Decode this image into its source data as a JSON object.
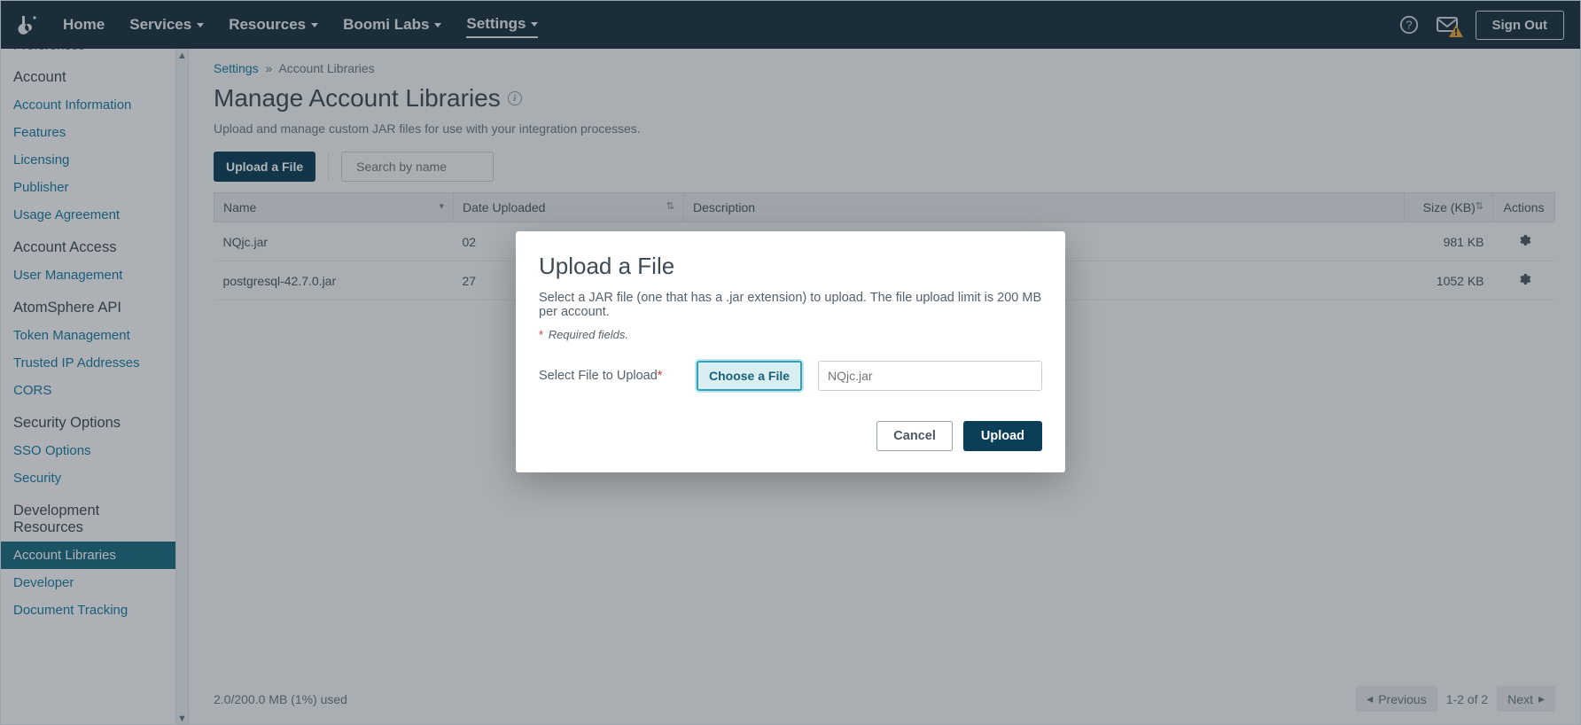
{
  "nav": {
    "home": "Home",
    "services": "Services",
    "resources": "Resources",
    "boomi_labs": "Boomi Labs",
    "settings": "Settings",
    "sign_out": "Sign Out"
  },
  "sidebar": {
    "cutoff_top": "Preferences",
    "groups": [
      {
        "title": "Account",
        "items": [
          "Account Information",
          "Features",
          "Licensing",
          "Publisher",
          "Usage Agreement"
        ]
      },
      {
        "title": "Account Access",
        "items": [
          "User Management"
        ]
      },
      {
        "title": "AtomSphere API",
        "items": [
          "Token Management",
          "Trusted IP Addresses",
          "CORS"
        ]
      },
      {
        "title": "Security Options",
        "items": [
          "SSO Options",
          "Security"
        ]
      },
      {
        "title": "Development Resources",
        "items": [
          "Account Libraries",
          "Developer",
          "Document Tracking"
        ],
        "active_index": 0
      }
    ]
  },
  "breadcrumb": {
    "root": "Settings",
    "sep": "»",
    "leaf": "Account Libraries"
  },
  "page": {
    "title": "Manage Account Libraries",
    "subtitle": "Upload and manage custom JAR files for use with your integration processes.",
    "upload_btn": "Upload a File",
    "search_placeholder": "Search by name"
  },
  "table": {
    "headers": {
      "name": "Name",
      "date": "Date Uploaded",
      "desc": "Description",
      "size": "Size (KB)",
      "actions": "Actions"
    },
    "rows": [
      {
        "name": "NQjc.jar",
        "date": "02",
        "desc": "",
        "size": "981 KB"
      },
      {
        "name": "postgresql-42.7.0.jar",
        "date": "27",
        "desc": "",
        "size": "1052 KB"
      }
    ]
  },
  "footer": {
    "usage": "2.0/200.0 MB (1%) used",
    "prev": "Previous",
    "next": "Next",
    "range": "1-2 of 2"
  },
  "modal": {
    "title": "Upload a File",
    "desc": "Select a JAR file (one that has a .jar extension) to upload. The file upload limit is 200 MB per account.",
    "required": "Required fields.",
    "label": "Select File to Upload",
    "choose": "Choose a File",
    "file_placeholder": "NQjc.jar",
    "cancel": "Cancel",
    "upload": "Upload"
  }
}
